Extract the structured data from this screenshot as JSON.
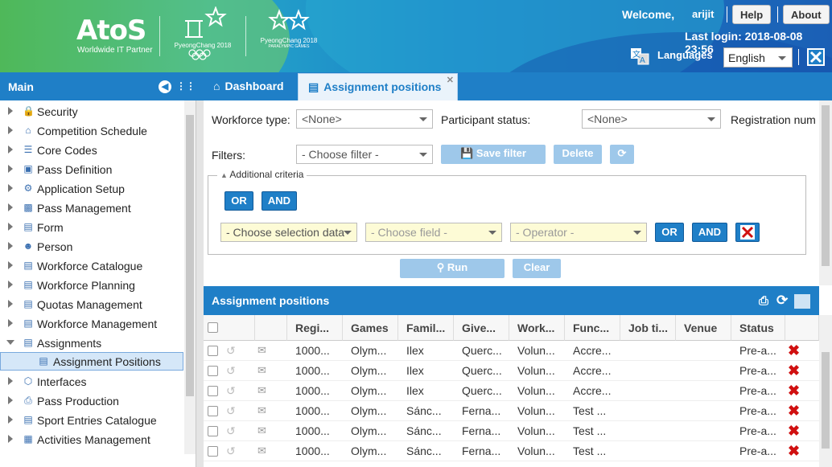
{
  "header": {
    "logo": "AtoS",
    "logo_sub": "Worldwide IT Partner",
    "olympic1": "PyeongChang 2018",
    "olympic2": "PyeongChang 2018",
    "olympic2_sub": "PARALYMPIC GAMES",
    "welcome": "Welcome,",
    "user": "arijit",
    "help": "Help",
    "about": "About",
    "last_login": "Last login: 2018-08-08 23:56",
    "languages": "Languages",
    "language_value": "English"
  },
  "sidebar": {
    "title": "Main",
    "items": [
      {
        "label": "Security",
        "icon": "lock-icon"
      },
      {
        "label": "Competition Schedule",
        "icon": "house-icon"
      },
      {
        "label": "Core Codes",
        "icon": "list-icon"
      },
      {
        "label": "Pass Definition",
        "icon": "card-icon"
      },
      {
        "label": "Application Setup",
        "icon": "gears-icon"
      },
      {
        "label": "Pass Management",
        "icon": "pass-icon"
      },
      {
        "label": "Form",
        "icon": "doc-icon"
      },
      {
        "label": "Person",
        "icon": "person-icon"
      },
      {
        "label": "Workforce Catalogue",
        "icon": "doc-icon"
      },
      {
        "label": "Workforce Planning",
        "icon": "doc-icon"
      },
      {
        "label": "Quotas Management",
        "icon": "doc-icon"
      },
      {
        "label": "Workforce Management",
        "icon": "doc-icon"
      },
      {
        "label": "Assignments",
        "icon": "doc-icon"
      },
      {
        "label": "Assignment Positions",
        "icon": "doc-icon"
      },
      {
        "label": "Interfaces",
        "icon": "cube-icon"
      },
      {
        "label": "Pass Production",
        "icon": "print-icon"
      },
      {
        "label": "Sport Entries Catalogue",
        "icon": "doc-icon"
      },
      {
        "label": "Activities Management",
        "icon": "calendar-icon"
      }
    ]
  },
  "tabs": [
    {
      "label": "Dashboard"
    },
    {
      "label": "Assignment positions"
    }
  ],
  "form": {
    "workforce_type_label": "Workforce type:",
    "workforce_type_value": "<None>",
    "participant_status_label": "Participant status:",
    "participant_status_value": "<None>",
    "registration_label": "Registration numb",
    "filters_label": "Filters:",
    "filter_placeholder": "- Choose filter -",
    "save_filter": "Save filter",
    "delete": "Delete",
    "additional_criteria": "Additional criteria",
    "or": "OR",
    "and": "AND",
    "choose_selection": "- Choose selection data",
    "choose_field": "- Choose field -",
    "operator": "- Operator -",
    "run": "Run",
    "clear": "Clear"
  },
  "grid": {
    "title": "Assignment positions",
    "columns": [
      "Regi...",
      "Games",
      "Famil...",
      "Give...",
      "Work...",
      "Func...",
      "Job ti...",
      "Venue",
      "Status"
    ],
    "rows": [
      [
        "1000...",
        "Olym...",
        "Ilex",
        "Querc...",
        "Volun...",
        "Accre...",
        "",
        "",
        "Pre-a..."
      ],
      [
        "1000...",
        "Olym...",
        "Ilex",
        "Querc...",
        "Volun...",
        "Accre...",
        "",
        "",
        "Pre-a..."
      ],
      [
        "1000...",
        "Olym...",
        "Ilex",
        "Querc...",
        "Volun...",
        "Accre...",
        "",
        "",
        "Pre-a..."
      ],
      [
        "1000...",
        "Olym...",
        "Sánc...",
        "Ferna...",
        "Volun...",
        "Test ...",
        "",
        "",
        "Pre-a..."
      ],
      [
        "1000...",
        "Olym...",
        "Sánc...",
        "Ferna...",
        "Volun...",
        "Test ...",
        "",
        "",
        "Pre-a..."
      ],
      [
        "1000...",
        "Olym...",
        "Sánc...",
        "Ferna...",
        "Volun...",
        "Test ...",
        "",
        "",
        "Pre-a..."
      ]
    ]
  }
}
